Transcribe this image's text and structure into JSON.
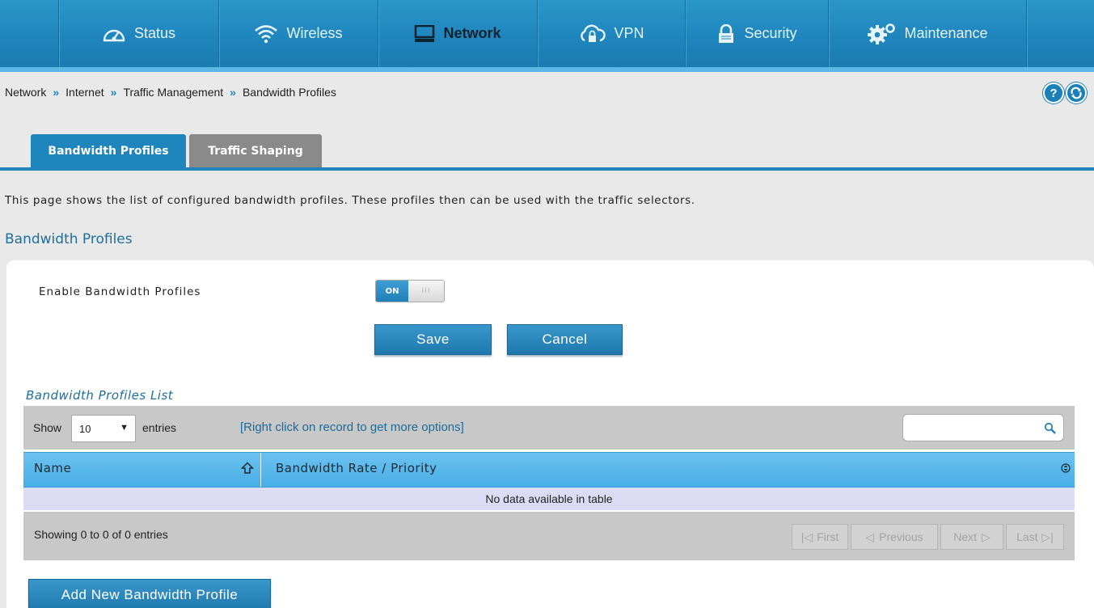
{
  "nav": {
    "items": [
      {
        "label": "Status",
        "icon": "gauge-icon"
      },
      {
        "label": "Wireless",
        "icon": "wifi-icon"
      },
      {
        "label": "Network",
        "icon": "monitor-icon",
        "active": true
      },
      {
        "label": "VPN",
        "icon": "cloud-lock-icon"
      },
      {
        "label": "Security",
        "icon": "padlock-icon"
      },
      {
        "label": "Maintenance",
        "icon": "gears-icon"
      }
    ]
  },
  "breadcrumb": {
    "items": [
      "Network",
      "Internet",
      "Traffic Management",
      "Bandwidth Profiles"
    ],
    "separator": "»"
  },
  "help_button": "?",
  "tabs": [
    {
      "label": "Bandwidth Profiles",
      "active": true
    },
    {
      "label": "Traffic Shaping",
      "active": false
    }
  ],
  "description": "This page shows the list of configured bandwidth profiles. These profiles then can be used with the traffic selectors.",
  "section_title": "Bandwidth Profiles",
  "settings": {
    "enable_label": "Enable Bandwidth Profiles",
    "toggle_on": "ON",
    "toggle_knob": "III",
    "save_label": "Save",
    "cancel_label": "Cancel"
  },
  "list": {
    "title": "Bandwidth Profiles List",
    "show_label": "Show",
    "entries_value": "10",
    "entries_label": "entries",
    "hint": "[Right click on record to get more options]",
    "search_placeholder": "",
    "columns": [
      "Name",
      "Bandwidth Rate / Priority"
    ],
    "empty_message": "No data available in table",
    "showing": "Showing 0 to 0 of 0 entries",
    "pagination": {
      "first": "First",
      "previous": "Previous",
      "next": "Next",
      "last": "Last"
    }
  },
  "add_button": "Add New Bandwidth Profile",
  "colors": {
    "accent": "#1f86bd",
    "header_row": "#48aee6",
    "empty_row": "#dcdcf5",
    "toolbar_gray": "#c8c8c8"
  }
}
